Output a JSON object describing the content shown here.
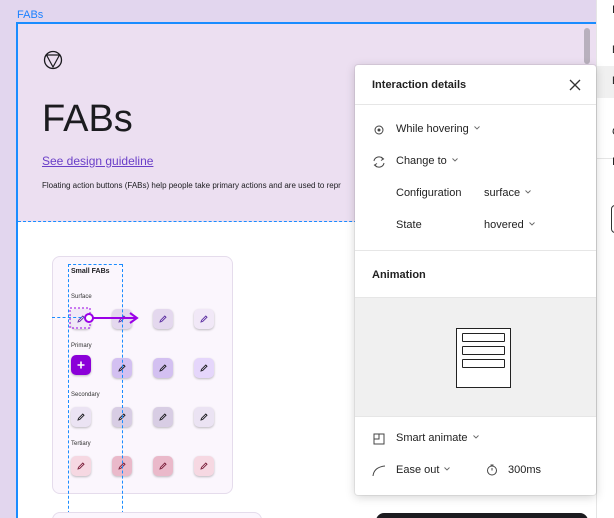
{
  "canvas": {
    "frame_label": "FABs"
  },
  "hero": {
    "title": "FABs",
    "link": "See design guideline",
    "description": "Floating action buttons (FABs) help people take primary actions and are used to repr"
  },
  "card": {
    "title": "Small FABs",
    "rows": [
      {
        "label": "Surface"
      },
      {
        "label": "Primary"
      },
      {
        "label": "Secondary"
      },
      {
        "label": "Tertiary"
      }
    ]
  },
  "panel": {
    "title": "Interaction details",
    "trigger": "While hovering",
    "action": "Change to",
    "configuration_label": "Configuration",
    "configuration_value": "surface",
    "state_label": "State",
    "state_value": "hovered",
    "animation_title": "Animation",
    "animation_type": "Smart animate",
    "easing": "Ease out",
    "duration": "300ms"
  },
  "colors": {
    "accent": "#1a8cff",
    "fab_primary": "#8b00d8",
    "prototype_arrow": "#9b00e8"
  },
  "icons": [
    "logo-icon",
    "edit-icon",
    "plus-icon",
    "close-icon",
    "hover-trigger-icon",
    "change-to-icon",
    "smart-animate-icon",
    "ease-out-icon",
    "timer-icon",
    "chevron-down-icon"
  ]
}
